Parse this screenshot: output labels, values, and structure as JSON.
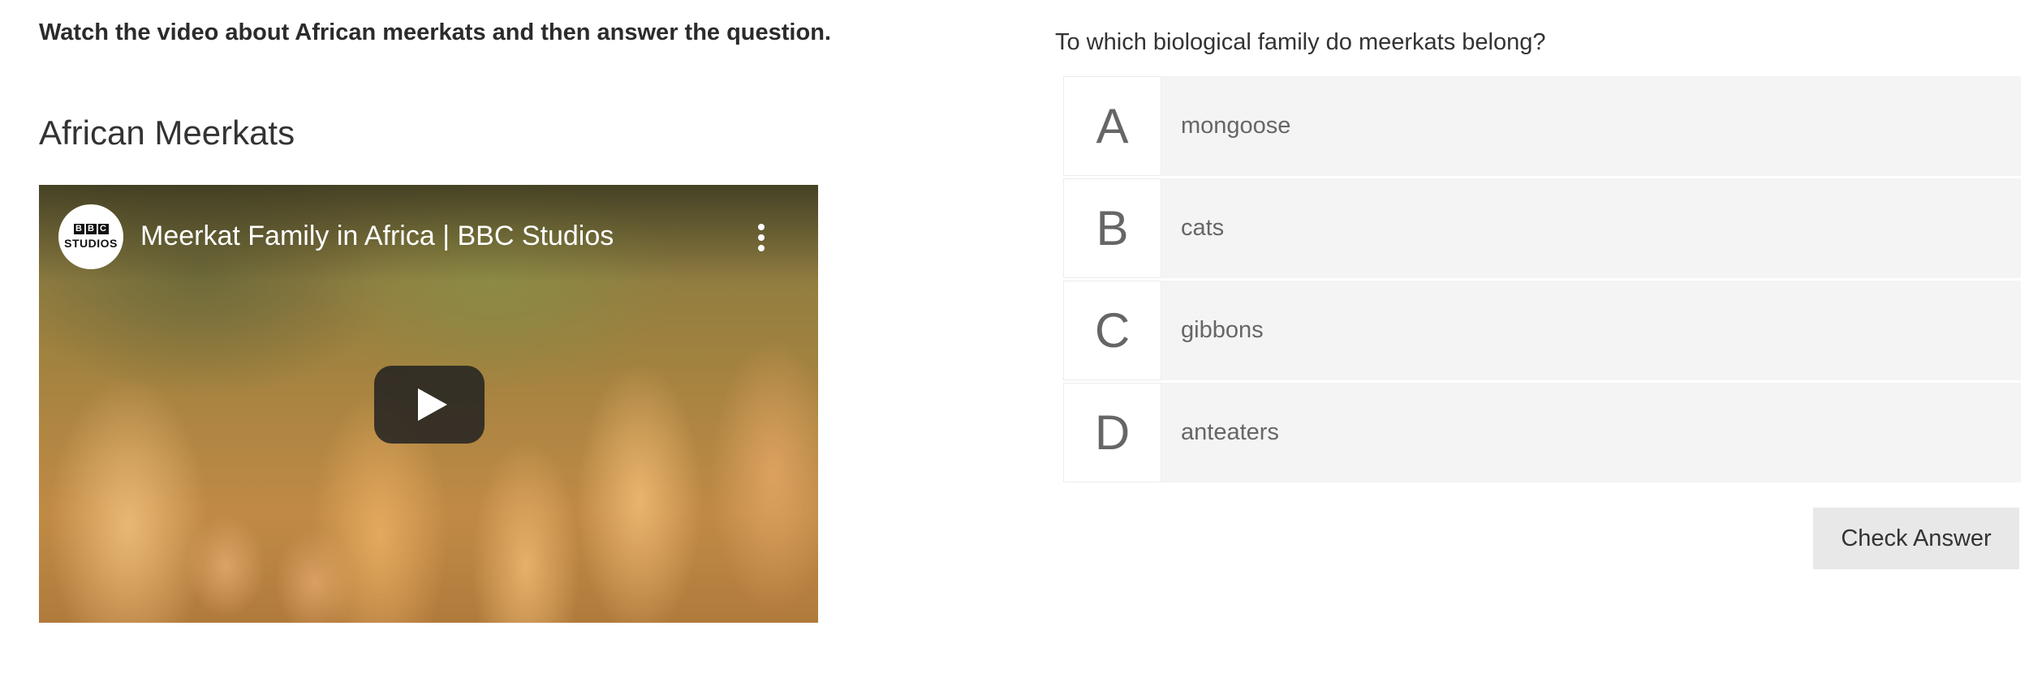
{
  "instruction": "Watch the video about African meerkats and then answer the question.",
  "section_title": "African Meerkats",
  "video": {
    "title": "Meerkat Family in Africa | BBC Studios",
    "channel_logo_top": "BBC",
    "channel_logo_bottom": "STUDIOS",
    "play_icon": "play-icon",
    "menu_icon": "more-vertical-icon"
  },
  "quiz": {
    "question": "To which biological family do meerkats belong?",
    "options": [
      {
        "letter": "A",
        "text": "mongoose"
      },
      {
        "letter": "B",
        "text": "cats"
      },
      {
        "letter": "C",
        "text": "gibbons"
      },
      {
        "letter": "D",
        "text": "anteaters"
      }
    ],
    "check_label": "Check Answer"
  },
  "colors": {
    "option_bg": "#f4f4f4",
    "letter_text": "#666666",
    "button_bg": "#e8e8e8"
  }
}
